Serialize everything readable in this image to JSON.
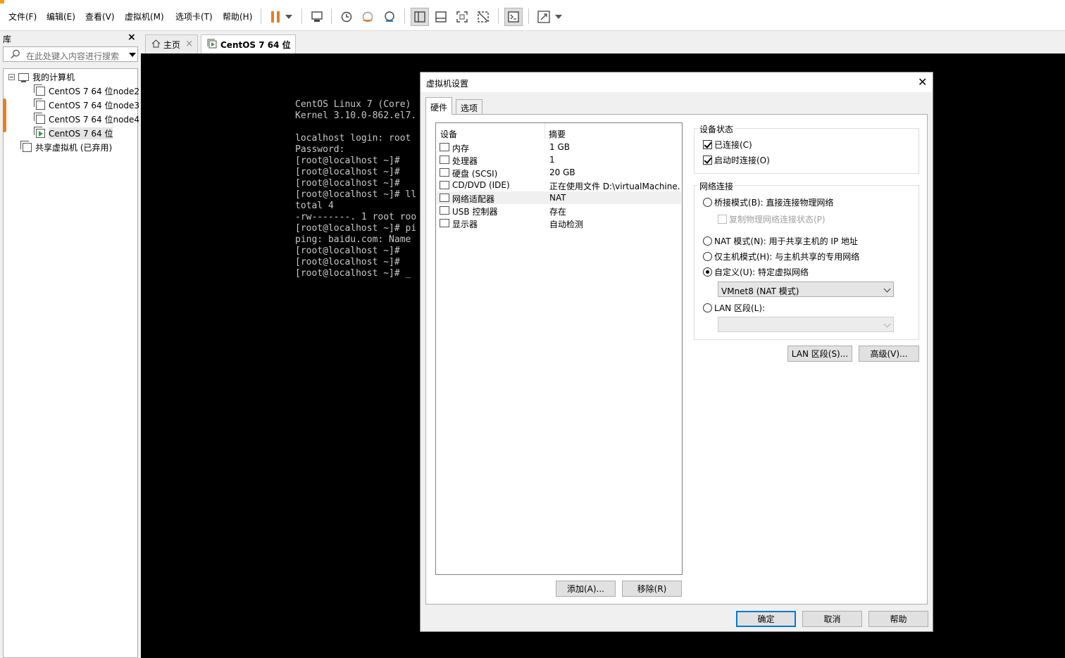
{
  "menu": {
    "file": "文件(F)",
    "edit": "编辑(E)",
    "view": "查看(V)",
    "vm": "虚拟机(M)",
    "tabs": "选项卡(T)",
    "help": "帮助(H)"
  },
  "toolbar_icons": [
    "pause-icon",
    "dropdown-icon",
    "send-ctrl-alt-del-icon",
    "snapshot-icon",
    "revert-snapshot-icon",
    "snapshot-manager-icon",
    "library-view-icon",
    "thumbnail-view-icon",
    "fullscreen-icon",
    "unity-icon",
    "console-icon",
    "stretch-icon"
  ],
  "library": {
    "title": "库",
    "close": "×",
    "search_placeholder": "在此处键入内容进行搜索",
    "root": "我的计算机",
    "vms": [
      "CentOS 7 64 位node2",
      "CentOS 7 64 位node3",
      "CentOS 7 64 位node4",
      "CentOS 7 64 位"
    ],
    "shared": "共享虚拟机 (已弃用)"
  },
  "tabs": {
    "home": "主页",
    "vm": "CentOS 7 64 位",
    "close": "×"
  },
  "console": {
    "lines": [
      "CentOS Linux 7 (Core)",
      "Kernel 3.10.0-862.el7.",
      "",
      "localhost login: root",
      "Password:",
      "[root@localhost ~]#",
      "[root@localhost ~]#",
      "[root@localhost ~]#",
      "[root@localhost ~]# ll",
      "total 4",
      "-rw-------. 1 root roo",
      "[root@localhost ~]# pi",
      "ping: baidu.com: Name",
      "[root@localhost ~]#",
      "[root@localhost ~]#",
      "[root@localhost ~]# _"
    ]
  },
  "dialog": {
    "title": "虚拟机设置",
    "close": "✕",
    "tab_hardware": "硬件",
    "tab_options": "选项",
    "col_device": "设备",
    "col_summary": "摘要",
    "devices": [
      {
        "name": "内存",
        "summary": "1 GB",
        "icon": "memory-icon"
      },
      {
        "name": "处理器",
        "summary": "1",
        "icon": "cpu-icon"
      },
      {
        "name": "硬盘 (SCSI)",
        "summary": "20 GB",
        "icon": "hard-disk-icon"
      },
      {
        "name": "CD/DVD (IDE)",
        "summary": "正在使用文件 D:\\virtualMachine...",
        "icon": "cd-dvd-icon"
      },
      {
        "name": "网络适配器",
        "summary": "NAT",
        "icon": "network-adapter-icon"
      },
      {
        "name": "USB 控制器",
        "summary": "存在",
        "icon": "usb-icon"
      },
      {
        "name": "显示器",
        "summary": "自动检测",
        "icon": "display-icon"
      }
    ],
    "add_button": "添加(A)...",
    "remove_button": "移除(R)",
    "device_status": {
      "title": "设备状态",
      "connected": "已连接(C)",
      "connect_at_power_on": "启动时连接(O)"
    },
    "network": {
      "title": "网络连接",
      "bridged": "桥接模式(B): 直接连接物理网络",
      "replicate": "复制物理网络连接状态(P)",
      "nat": "NAT 模式(N): 用于共享主机的 IP 地址",
      "host_only": "仅主机模式(H): 与主机共享的专用网络",
      "custom": "自定义(U): 特定虚拟网络",
      "custom_value": "VMnet8 (NAT 模式)",
      "lan_segment": "LAN 区段(L):",
      "lan_segment_value": ""
    },
    "lan_segments_button": "LAN 区段(S)...",
    "advanced_button": "高级(V)...",
    "ok": "确定",
    "cancel": "取消",
    "help": "帮助"
  },
  "colors": {
    "accent": "#e67e22",
    "selection_border": "#0078d7",
    "console_bg": "#000000"
  }
}
